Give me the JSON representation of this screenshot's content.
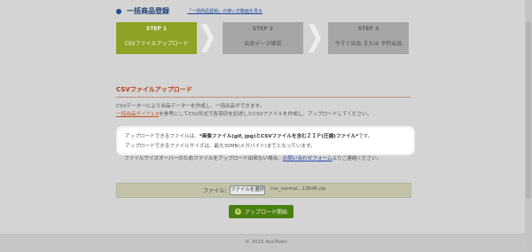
{
  "header": {
    "title": "一括商品登録",
    "usage_link": "「一括商品登録」の使い方動画を見る"
  },
  "steps": [
    {
      "step": "STEP 1",
      "label": "CSVファイルアップロード",
      "active": true
    },
    {
      "step": "STEP 2",
      "label": "出品データ確認",
      "active": false
    },
    {
      "step": "STEP 3",
      "label": "今すぐ出品 または 予約出品",
      "active": false
    }
  ],
  "section": {
    "title": "CSVファイルアップロード",
    "p1": "CSVデーターにより出品データーを作成し、一括出品ができます。",
    "p2_link": "一括出品ガイド1.6",
    "p2_rest": "を参考にしてCSV形式で各項目を記述したCSVファイルを作成し、アップロードしてください。",
    "hl1_prefix": "アップロードできるファイルは、",
    "hl1_bold": "*画像ファイル(gif, jpg)とCSVファイルを含むＺＩＰ(圧縮)ファイル*",
    "hl1_suffix": "です。",
    "hl2": "アップロードできるファイルサイズは、最大30MB(メガバイト)までとなっています。",
    "p3_prefix": "ファイルサイズオーバーのためファイルをアップロード出来ない場合、",
    "p3_link": "お問い合わせフォーム",
    "p3_suffix": "よりご連絡ください。"
  },
  "file_input": {
    "label": "ファイル：",
    "button": "ファイルを選択",
    "file_name": "csv_normal...13646.zip"
  },
  "upload_button": {
    "label": "アップロード開始",
    "icon": "plus-circle-icon"
  },
  "footer": {
    "copyright": "© 2015 AucTown"
  },
  "colors": {
    "active_step": "#8ea325",
    "section_title": "#b13a14",
    "upload_button": "#4a7f12"
  }
}
